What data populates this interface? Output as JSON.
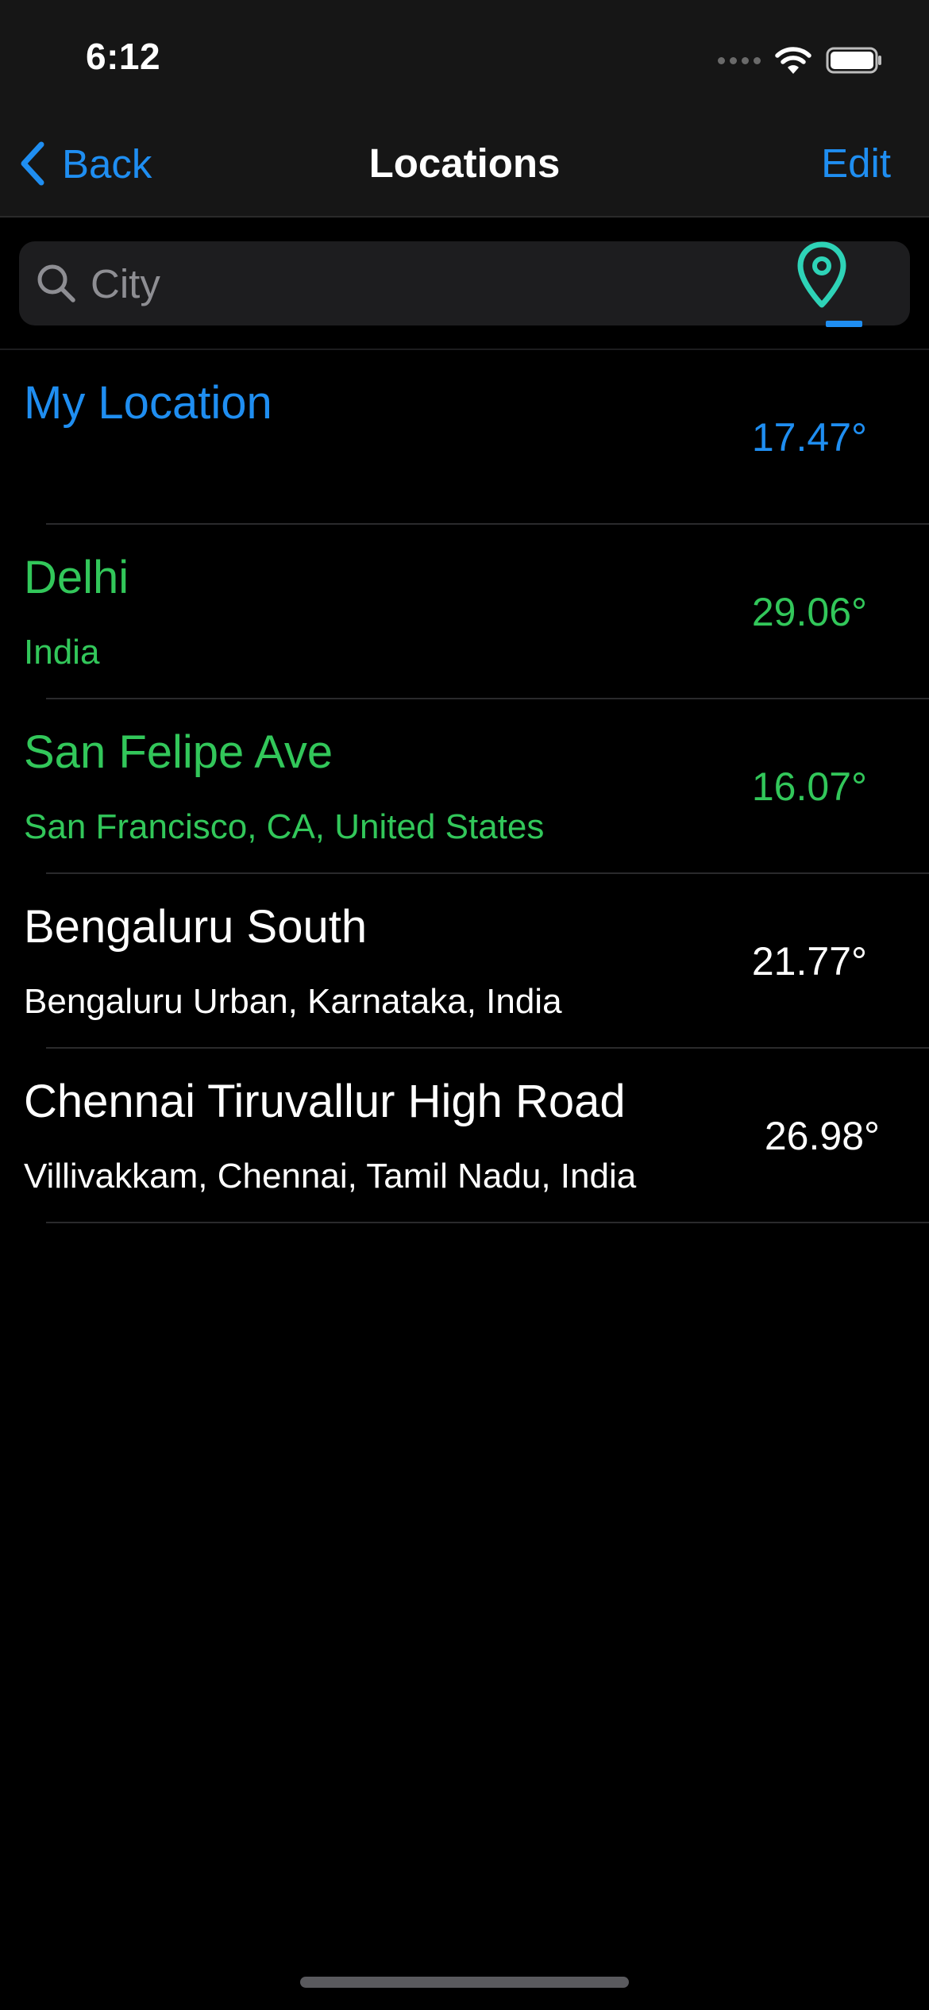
{
  "status_bar": {
    "time": "6:12"
  },
  "nav": {
    "back_label": "Back",
    "title": "Locations",
    "edit_label": "Edit"
  },
  "search": {
    "placeholder": "City",
    "value": ""
  },
  "locations": [
    {
      "name": "My Location",
      "subtitle": "",
      "temperature": "17.47°",
      "color": "#1f8ef1"
    },
    {
      "name": "Delhi",
      "subtitle": "India",
      "temperature": "29.06°",
      "color": "#32c75a"
    },
    {
      "name": "San Felipe Ave",
      "subtitle": "San Francisco, CA, United States",
      "temperature": "16.07°",
      "color": "#32c75a"
    },
    {
      "name": "Bengaluru South",
      "subtitle": "Bengaluru Urban, Karnataka, India",
      "temperature": "21.77°",
      "color": "#ffffff"
    },
    {
      "name": "Chennai Tiruvallur High Road",
      "subtitle": "Villivakkam, Chennai, Tamil Nadu, India",
      "temperature": "26.98°",
      "color": "#ffffff"
    }
  ],
  "colors": {
    "accent": "#1f8ef1",
    "pin": "#2ed3b7",
    "saved_green": "#32c75a",
    "background": "#000000",
    "bar": "#161616"
  },
  "icons": {
    "back": "chevron-left-icon",
    "search": "magnifier-icon",
    "current_location": "map-pin-icon",
    "wifi": "wifi-icon",
    "battery": "battery-icon"
  }
}
